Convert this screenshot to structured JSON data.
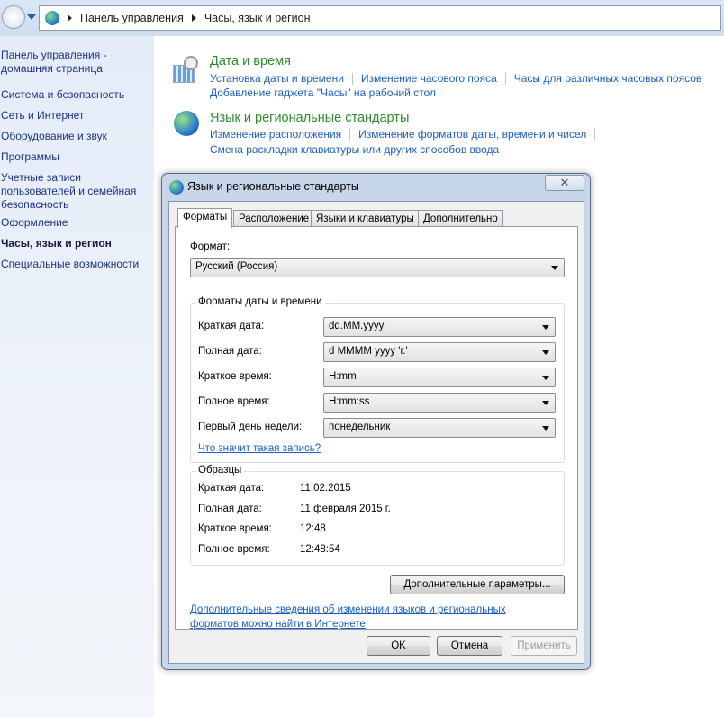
{
  "address": {
    "crumbs": [
      "Панель управления",
      "Часы, язык и регион"
    ]
  },
  "sidebar": {
    "items": [
      "Панель управления - домашняя страница",
      "Система и безопасность",
      "Сеть и Интернет",
      "Оборудование и звук",
      "Программы",
      "Учетные записи пользователей и семейная безопасность",
      "Оформление",
      "Часы, язык и регион",
      "Специальные возможности"
    ]
  },
  "main": {
    "datetime": {
      "title": "Дата и время",
      "links": [
        "Установка даты и времени",
        "Изменение часового пояса",
        "Часы для различных часовых поясов",
        "Добавление гаджета \"Часы\" на рабочий стол"
      ]
    },
    "region": {
      "title": "Язык и региональные стандарты",
      "links": [
        "Изменение расположения",
        "Изменение форматов даты, времени и чисел",
        "Смена раскладки клавиатуры или других способов ввода"
      ]
    }
  },
  "dialog": {
    "title": "Язык и региональные стандарты",
    "close": "✕",
    "tabs": [
      "Форматы",
      "Расположение",
      "Языки и клавиатуры",
      "Дополнительно"
    ],
    "format_label": "Формат:",
    "format_value": "Русский (Россия)",
    "dt_group": "Форматы даты и времени",
    "rows": [
      {
        "label": "Краткая дата:",
        "value": "dd.MM.yyyy"
      },
      {
        "label": "Полная дата:",
        "value": "d MMMM yyyy 'г.'"
      },
      {
        "label": "Краткое время:",
        "value": "H:mm"
      },
      {
        "label": "Полное время:",
        "value": "H:mm:ss"
      },
      {
        "label": "Первый день недели:",
        "value": "понедельник"
      }
    ],
    "what_link": "Что значит такая запись?",
    "samples_group": "Образцы",
    "samples": [
      {
        "label": "Краткая дата:",
        "value": "11.02.2015"
      },
      {
        "label": "Полная дата:",
        "value": "11 февраля 2015 г."
      },
      {
        "label": "Краткое время:",
        "value": "12:48"
      },
      {
        "label": "Полное время:",
        "value": "12:48:54"
      }
    ],
    "advanced_button": "Дополнительные параметры...",
    "info_link_1": "Дополнительные сведения об изменении языков и региональных",
    "info_link_2": "форматов можно найти в Интернете",
    "ok": "OK",
    "cancel": "Отмена",
    "apply": "Применить"
  }
}
